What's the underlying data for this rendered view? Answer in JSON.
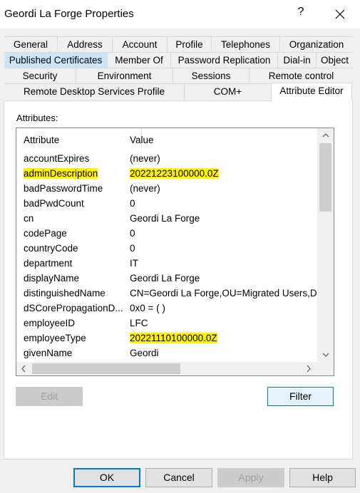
{
  "window": {
    "title": "Geordi La Forge Properties",
    "help_glyph": "?"
  },
  "tabs": {
    "row1": [
      "General",
      "Address",
      "Account",
      "Profile",
      "Telephones",
      "Organization"
    ],
    "row2": [
      "Published Certificates",
      "Member Of",
      "Password Replication",
      "Dial-in",
      "Object"
    ],
    "row3": [
      "Security",
      "Environment",
      "Sessions",
      "Remote control"
    ],
    "row4": [
      "Remote Desktop Services Profile",
      "COM+"
    ],
    "active": "Attribute Editor"
  },
  "attributes_label": "Attributes:",
  "columns": {
    "attribute": "Attribute",
    "value": "Value"
  },
  "rows": [
    {
      "name": "accountExpires",
      "value": "(never)"
    },
    {
      "name": "adminDescription",
      "value": "20221223100000.0Z"
    },
    {
      "name": "badPasswordTime",
      "value": "(never)"
    },
    {
      "name": "badPwdCount",
      "value": "0"
    },
    {
      "name": "cn",
      "value": "Geordi La Forge"
    },
    {
      "name": "codePage",
      "value": "0"
    },
    {
      "name": "countryCode",
      "value": "0"
    },
    {
      "name": "department",
      "value": "IT"
    },
    {
      "name": "displayName",
      "value": "Geordi La Forge"
    },
    {
      "name": "distinguishedName",
      "value": "CN=Geordi La Forge,OU=Migrated Users,DC"
    },
    {
      "name": "dSCorePropagationD...",
      "value": "0x0 = ( )"
    },
    {
      "name": "employeeID",
      "value": "LFC"
    },
    {
      "name": "employeeType",
      "value": "20221110100000.0Z"
    },
    {
      "name": "givenName",
      "value": "Geordi"
    }
  ],
  "highlight_color": "#fff200",
  "buttons": {
    "edit": "Edit",
    "filter": "Filter",
    "ok": "OK",
    "cancel": "Cancel",
    "apply": "Apply",
    "help": "Help"
  }
}
